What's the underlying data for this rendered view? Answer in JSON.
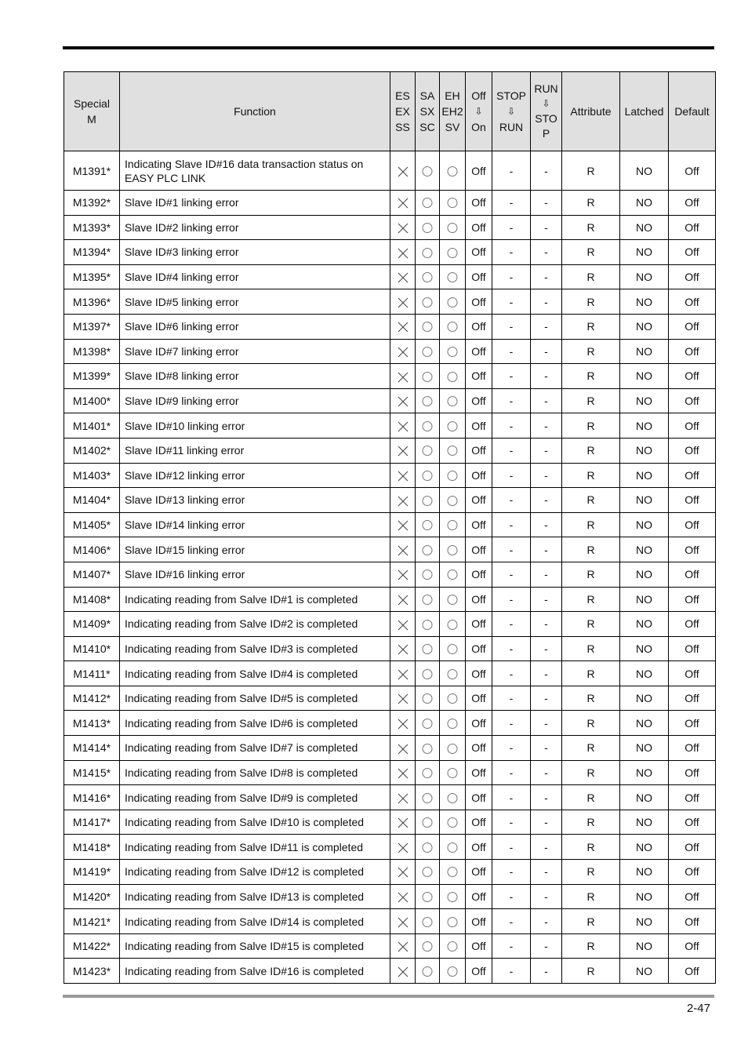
{
  "page": {
    "number": "2-47"
  },
  "table": {
    "headers": {
      "special_m": [
        "Special",
        "M"
      ],
      "function": "Function",
      "es": [
        "ES",
        "EX",
        "SS"
      ],
      "sa": [
        "SA",
        "SX",
        "SC"
      ],
      "eh": [
        "EH",
        "EH2",
        "SV"
      ],
      "off_on": [
        "Off",
        "⇩",
        "On"
      ],
      "stop_run": [
        "STOP",
        "⇩",
        "RUN"
      ],
      "run_stop": [
        "RUN",
        "⇩",
        "STO",
        "P"
      ],
      "attribute": "Attribute",
      "latched": "Latched",
      "default": "Default"
    },
    "symbols": {
      "x": "not-supported",
      "o": "supported"
    },
    "rows": [
      {
        "m": "M1391*",
        "function": [
          "Indicating Slave ID#16 data transaction status on",
          "EASY PLC LINK"
        ],
        "es": "x",
        "sa": "o",
        "eh": "o",
        "off_on": "Off",
        "stop_run": "-",
        "run_stop": "-",
        "attribute": "R",
        "latched": "NO",
        "default": "Off"
      },
      {
        "m": "M1392*",
        "function": [
          "Slave ID#1 linking error"
        ],
        "es": "x",
        "sa": "o",
        "eh": "o",
        "off_on": "Off",
        "stop_run": "-",
        "run_stop": "-",
        "attribute": "R",
        "latched": "NO",
        "default": "Off"
      },
      {
        "m": "M1393*",
        "function": [
          "Slave ID#2 linking error"
        ],
        "es": "x",
        "sa": "o",
        "eh": "o",
        "off_on": "Off",
        "stop_run": "-",
        "run_stop": "-",
        "attribute": "R",
        "latched": "NO",
        "default": "Off"
      },
      {
        "m": "M1394*",
        "function": [
          "Slave ID#3 linking error"
        ],
        "es": "x",
        "sa": "o",
        "eh": "o",
        "off_on": "Off",
        "stop_run": "-",
        "run_stop": "-",
        "attribute": "R",
        "latched": "NO",
        "default": "Off"
      },
      {
        "m": "M1395*",
        "function": [
          "Slave ID#4 linking error"
        ],
        "es": "x",
        "sa": "o",
        "eh": "o",
        "off_on": "Off",
        "stop_run": "-",
        "run_stop": "-",
        "attribute": "R",
        "latched": "NO",
        "default": "Off"
      },
      {
        "m": "M1396*",
        "function": [
          "Slave ID#5 linking error"
        ],
        "es": "x",
        "sa": "o",
        "eh": "o",
        "off_on": "Off",
        "stop_run": "-",
        "run_stop": "-",
        "attribute": "R",
        "latched": "NO",
        "default": "Off"
      },
      {
        "m": "M1397*",
        "function": [
          "Slave ID#6 linking error"
        ],
        "es": "x",
        "sa": "o",
        "eh": "o",
        "off_on": "Off",
        "stop_run": "-",
        "run_stop": "-",
        "attribute": "R",
        "latched": "NO",
        "default": "Off"
      },
      {
        "m": "M1398*",
        "function": [
          "Slave ID#7 linking error"
        ],
        "es": "x",
        "sa": "o",
        "eh": "o",
        "off_on": "Off",
        "stop_run": "-",
        "run_stop": "-",
        "attribute": "R",
        "latched": "NO",
        "default": "Off"
      },
      {
        "m": "M1399*",
        "function": [
          "Slave ID#8 linking error"
        ],
        "es": "x",
        "sa": "o",
        "eh": "o",
        "off_on": "Off",
        "stop_run": "-",
        "run_stop": "-",
        "attribute": "R",
        "latched": "NO",
        "default": "Off"
      },
      {
        "m": "M1400*",
        "function": [
          "Slave ID#9 linking error"
        ],
        "es": "x",
        "sa": "o",
        "eh": "o",
        "off_on": "Off",
        "stop_run": "-",
        "run_stop": "-",
        "attribute": "R",
        "latched": "NO",
        "default": "Off"
      },
      {
        "m": "M1401*",
        "function": [
          "Slave ID#10 linking error"
        ],
        "es": "x",
        "sa": "o",
        "eh": "o",
        "off_on": "Off",
        "stop_run": "-",
        "run_stop": "-",
        "attribute": "R",
        "latched": "NO",
        "default": "Off"
      },
      {
        "m": "M1402*",
        "function": [
          "Slave ID#11 linking error"
        ],
        "es": "x",
        "sa": "o",
        "eh": "o",
        "off_on": "Off",
        "stop_run": "-",
        "run_stop": "-",
        "attribute": "R",
        "latched": "NO",
        "default": "Off"
      },
      {
        "m": "M1403*",
        "function": [
          "Slave ID#12 linking error"
        ],
        "es": "x",
        "sa": "o",
        "eh": "o",
        "off_on": "Off",
        "stop_run": "-",
        "run_stop": "-",
        "attribute": "R",
        "latched": "NO",
        "default": "Off"
      },
      {
        "m": "M1404*",
        "function": [
          "Slave ID#13 linking error"
        ],
        "es": "x",
        "sa": "o",
        "eh": "o",
        "off_on": "Off",
        "stop_run": "-",
        "run_stop": "-",
        "attribute": "R",
        "latched": "NO",
        "default": "Off"
      },
      {
        "m": "M1405*",
        "function": [
          "Slave ID#14 linking error"
        ],
        "es": "x",
        "sa": "o",
        "eh": "o",
        "off_on": "Off",
        "stop_run": "-",
        "run_stop": "-",
        "attribute": "R",
        "latched": "NO",
        "default": "Off"
      },
      {
        "m": "M1406*",
        "function": [
          "Slave ID#15 linking error"
        ],
        "es": "x",
        "sa": "o",
        "eh": "o",
        "off_on": "Off",
        "stop_run": "-",
        "run_stop": "-",
        "attribute": "R",
        "latched": "NO",
        "default": "Off"
      },
      {
        "m": "M1407*",
        "function": [
          "Slave ID#16 linking error"
        ],
        "es": "x",
        "sa": "o",
        "eh": "o",
        "off_on": "Off",
        "stop_run": "-",
        "run_stop": "-",
        "attribute": "R",
        "latched": "NO",
        "default": "Off"
      },
      {
        "m": "M1408*",
        "function": [
          "Indicating reading from Salve ID#1 is completed"
        ],
        "es": "x",
        "sa": "o",
        "eh": "o",
        "off_on": "Off",
        "stop_run": "-",
        "run_stop": "-",
        "attribute": "R",
        "latched": "NO",
        "default": "Off"
      },
      {
        "m": "M1409*",
        "function": [
          "Indicating reading from Salve ID#2 is completed"
        ],
        "es": "x",
        "sa": "o",
        "eh": "o",
        "off_on": "Off",
        "stop_run": "-",
        "run_stop": "-",
        "attribute": "R",
        "latched": "NO",
        "default": "Off"
      },
      {
        "m": "M1410*",
        "function": [
          "Indicating reading from Salve ID#3 is completed"
        ],
        "es": "x",
        "sa": "o",
        "eh": "o",
        "off_on": "Off",
        "stop_run": "-",
        "run_stop": "-",
        "attribute": "R",
        "latched": "NO",
        "default": "Off"
      },
      {
        "m": "M1411*",
        "function": [
          "Indicating reading from Salve ID#4 is completed"
        ],
        "es": "x",
        "sa": "o",
        "eh": "o",
        "off_on": "Off",
        "stop_run": "-",
        "run_stop": "-",
        "attribute": "R",
        "latched": "NO",
        "default": "Off"
      },
      {
        "m": "M1412*",
        "function": [
          "Indicating reading from Salve ID#5 is completed"
        ],
        "es": "x",
        "sa": "o",
        "eh": "o",
        "off_on": "Off",
        "stop_run": "-",
        "run_stop": "-",
        "attribute": "R",
        "latched": "NO",
        "default": "Off"
      },
      {
        "m": "M1413*",
        "function": [
          "Indicating reading from Salve ID#6 is completed"
        ],
        "es": "x",
        "sa": "o",
        "eh": "o",
        "off_on": "Off",
        "stop_run": "-",
        "run_stop": "-",
        "attribute": "R",
        "latched": "NO",
        "default": "Off"
      },
      {
        "m": "M1414*",
        "function": [
          "Indicating reading from Salve ID#7 is completed"
        ],
        "es": "x",
        "sa": "o",
        "eh": "o",
        "off_on": "Off",
        "stop_run": "-",
        "run_stop": "-",
        "attribute": "R",
        "latched": "NO",
        "default": "Off"
      },
      {
        "m": "M1415*",
        "function": [
          "Indicating reading from Salve ID#8 is completed"
        ],
        "es": "x",
        "sa": "o",
        "eh": "o",
        "off_on": "Off",
        "stop_run": "-",
        "run_stop": "-",
        "attribute": "R",
        "latched": "NO",
        "default": "Off"
      },
      {
        "m": "M1416*",
        "function": [
          "Indicating reading from Salve ID#9 is completed"
        ],
        "es": "x",
        "sa": "o",
        "eh": "o",
        "off_on": "Off",
        "stop_run": "-",
        "run_stop": "-",
        "attribute": "R",
        "latched": "NO",
        "default": "Off"
      },
      {
        "m": "M1417*",
        "function": [
          "Indicating reading from Salve ID#10 is completed"
        ],
        "es": "x",
        "sa": "o",
        "eh": "o",
        "off_on": "Off",
        "stop_run": "-",
        "run_stop": "-",
        "attribute": "R",
        "latched": "NO",
        "default": "Off"
      },
      {
        "m": "M1418*",
        "function": [
          "Indicating reading from Salve ID#11 is completed"
        ],
        "es": "x",
        "sa": "o",
        "eh": "o",
        "off_on": "Off",
        "stop_run": "-",
        "run_stop": "-",
        "attribute": "R",
        "latched": "NO",
        "default": "Off"
      },
      {
        "m": "M1419*",
        "function": [
          "Indicating reading from Salve ID#12 is completed"
        ],
        "es": "x",
        "sa": "o",
        "eh": "o",
        "off_on": "Off",
        "stop_run": "-",
        "run_stop": "-",
        "attribute": "R",
        "latched": "NO",
        "default": "Off"
      },
      {
        "m": "M1420*",
        "function": [
          "Indicating reading from Salve ID#13 is completed"
        ],
        "es": "x",
        "sa": "o",
        "eh": "o",
        "off_on": "Off",
        "stop_run": "-",
        "run_stop": "-",
        "attribute": "R",
        "latched": "NO",
        "default": "Off"
      },
      {
        "m": "M1421*",
        "function": [
          "Indicating reading from Salve ID#14 is completed"
        ],
        "es": "x",
        "sa": "o",
        "eh": "o",
        "off_on": "Off",
        "stop_run": "-",
        "run_stop": "-",
        "attribute": "R",
        "latched": "NO",
        "default": "Off"
      },
      {
        "m": "M1422*",
        "function": [
          "Indicating reading from Salve ID#15 is completed"
        ],
        "es": "x",
        "sa": "o",
        "eh": "o",
        "off_on": "Off",
        "stop_run": "-",
        "run_stop": "-",
        "attribute": "R",
        "latched": "NO",
        "default": "Off"
      },
      {
        "m": "M1423*",
        "function": [
          "Indicating reading from Salve ID#16 is completed"
        ],
        "es": "x",
        "sa": "o",
        "eh": "o",
        "off_on": "Off",
        "stop_run": "-",
        "run_stop": "-",
        "attribute": "R",
        "latched": "NO",
        "default": "Off"
      }
    ]
  }
}
